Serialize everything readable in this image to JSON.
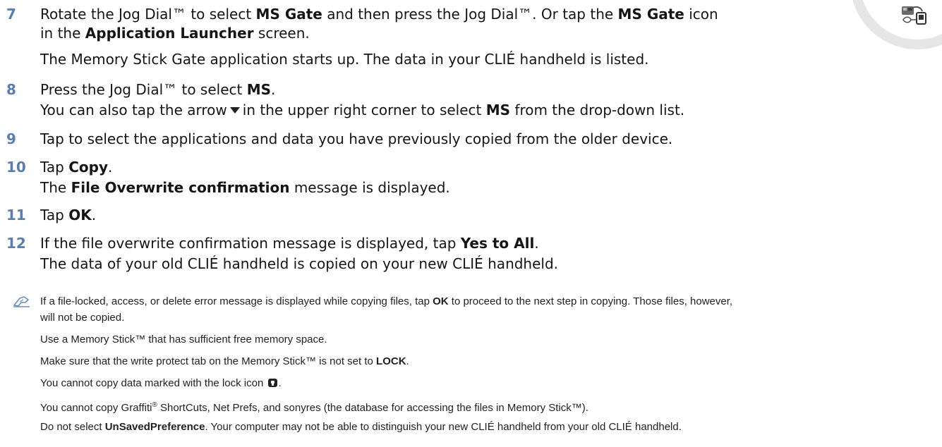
{
  "colors": {
    "step_number": "#5a7eae",
    "text": "#151515",
    "ring": "#e6e6e6"
  },
  "icons": [
    "ms-gate-icon",
    "arrow-down-icon",
    "note-hand-icon",
    "lock-icon"
  ],
  "steps": [
    {
      "number": "7",
      "l1": [
        "Rotate the Jog Dial™ to select ",
        "MS Gate",
        " and then press the Jog Dial™. Or tap the ",
        "MS Gate",
        " icon"
      ],
      "l2": [
        "in the ",
        "Application Launcher",
        " screen."
      ],
      "l3": "The Memory Stick Gate application starts up. The data in your CLIÉ handheld is listed."
    },
    {
      "number": "8",
      "l1": [
        "Press the Jog Dial™ to select ",
        "MS",
        "."
      ],
      "l2": [
        "You can also tap the arrow",
        "in the upper right corner to select ",
        "MS",
        " from the drop-down list."
      ]
    },
    {
      "number": "9",
      "l1": "Tap to select the applications and data you have previously copied from the older device."
    },
    {
      "number": "10",
      "l1": [
        "Tap ",
        "Copy",
        "."
      ],
      "l2": [
        "The ",
        "File Overwrite confirmation",
        " message is displayed."
      ]
    },
    {
      "number": "11",
      "l1": [
        "Tap ",
        "OK",
        "."
      ]
    },
    {
      "number": "12",
      "l1": [
        "If the file overwrite confirmation message is displayed, tap ",
        "Yes to All",
        "."
      ],
      "l2": "The data of your old CLIÉ handheld is copied on your new CLIÉ handheld."
    }
  ],
  "notes": {
    "n1a": [
      "If a file-locked, access, or delete error message is displayed while copying files, tap ",
      "OK",
      " to proceed to the next step in copying. Those files, however,"
    ],
    "n1b": "will not be copied.",
    "n2": "Use a Memory Stick™ that has sufficient free memory space.",
    "n3": [
      "Make sure that the write protect tab on the Memory Stick™ is not set to ",
      "LOCK",
      "."
    ],
    "n4": [
      "You cannot copy data marked with the lock icon",
      "."
    ],
    "n5": [
      "You cannot copy Graffiti",
      "®",
      " ShortCuts, Net Prefs, and sonyres (the database for accessing the files in Memory Stick™)."
    ],
    "n6": [
      "Do not select ",
      "UnSavedPreference",
      ". Your computer may not be able to distinguish your new CLIÉ handheld from your old CLIÉ handheld."
    ]
  }
}
